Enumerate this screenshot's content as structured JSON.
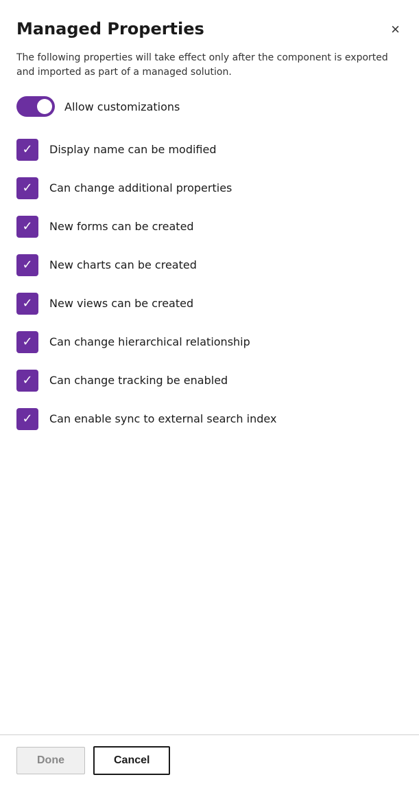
{
  "dialog": {
    "title": "Managed Properties",
    "description": "The following properties will take effect only after the component is exported and imported as part of a managed solution.",
    "close_label": "×"
  },
  "toggle": {
    "label": "Allow customizations",
    "enabled": true
  },
  "checkboxes": [
    {
      "label": "Display name can be modified",
      "checked": true
    },
    {
      "label": "Can change additional properties",
      "checked": true
    },
    {
      "label": "New forms can be created",
      "checked": true
    },
    {
      "label": "New charts can be created",
      "checked": true
    },
    {
      "label": "New views can be created",
      "checked": true
    },
    {
      "label": "Can change hierarchical relationship",
      "checked": true
    },
    {
      "label": "Can change tracking be enabled",
      "checked": true
    },
    {
      "label": "Can enable sync to external search index",
      "checked": true
    }
  ],
  "footer": {
    "done_label": "Done",
    "cancel_label": "Cancel"
  },
  "colors": {
    "accent": "#6b2fa0"
  }
}
